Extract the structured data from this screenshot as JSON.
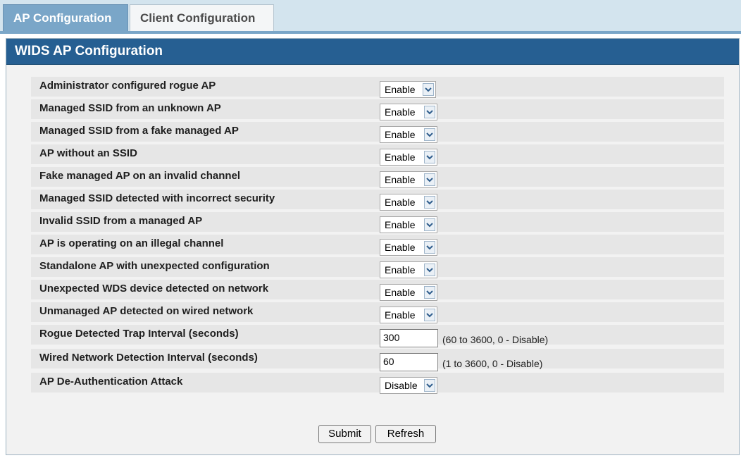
{
  "tabs": [
    {
      "label": "AP Configuration",
      "active": true
    },
    {
      "label": "Client Configuration",
      "active": false
    }
  ],
  "panel": {
    "title": "WIDS AP Configuration"
  },
  "rows": [
    {
      "label": "Administrator configured rogue AP",
      "control": "select",
      "value": "Enable"
    },
    {
      "label": "Managed SSID from an unknown AP",
      "control": "select",
      "value": "Enable"
    },
    {
      "label": "Managed SSID from a fake managed AP",
      "control": "select",
      "value": "Enable"
    },
    {
      "label": "AP without an SSID",
      "control": "select",
      "value": "Enable"
    },
    {
      "label": "Fake managed AP on an invalid channel",
      "control": "select",
      "value": "Enable"
    },
    {
      "label": "Managed SSID detected with incorrect security",
      "control": "select",
      "value": "Enable"
    },
    {
      "label": "Invalid SSID from a managed AP",
      "control": "select",
      "value": "Enable"
    },
    {
      "label": "AP is operating on an illegal channel",
      "control": "select",
      "value": "Enable"
    },
    {
      "label": "Standalone AP with unexpected configuration",
      "control": "select",
      "value": "Enable"
    },
    {
      "label": "Unexpected WDS device detected on network",
      "control": "select",
      "value": "Enable"
    },
    {
      "label": "Unmanaged AP detected on wired network",
      "control": "select",
      "value": "Enable"
    },
    {
      "label": "Rogue Detected Trap Interval (seconds)",
      "control": "input",
      "value": "300",
      "hint": "(60 to 3600, 0 - Disable)"
    },
    {
      "label": "Wired Network Detection Interval (seconds)",
      "control": "input",
      "value": "60",
      "hint": "(1 to 3600, 0 - Disable)"
    },
    {
      "label": "AP De-Authentication Attack",
      "control": "select",
      "value": "Disable"
    }
  ],
  "buttons": {
    "submit": "Submit",
    "refresh": "Refresh"
  },
  "icons": {
    "dropdown": "chevron-down-icon"
  },
  "colors": {
    "header": "#265f92",
    "active_tab": "#7aa6c8",
    "tab_bar": "#d3e4ee",
    "row_bg": "#e6e6e6"
  }
}
